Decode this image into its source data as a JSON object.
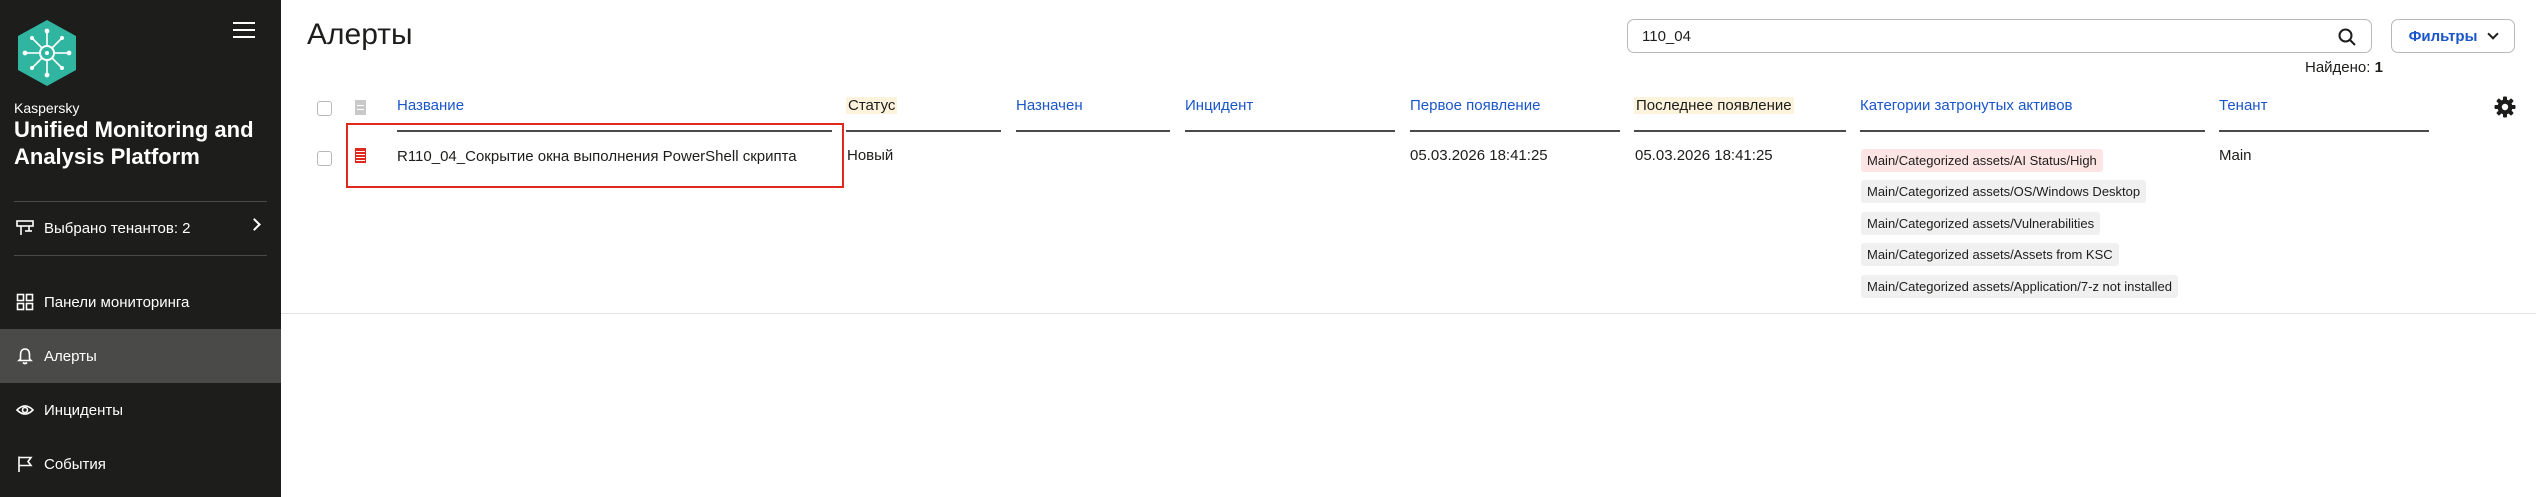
{
  "sidebar": {
    "brand_small": "Kaspersky",
    "brand_title": "Unified Monitoring and Analysis Platform",
    "tenants_label": "Выбрано тенантов: 2",
    "items": [
      {
        "label": "Панели мониторинга",
        "icon": "dashboard-icon",
        "active": false
      },
      {
        "label": "Алерты",
        "icon": "bell-icon",
        "active": true
      },
      {
        "label": "Инциденты",
        "icon": "eye-icon",
        "active": false
      },
      {
        "label": "События",
        "icon": "flag-icon",
        "active": false
      }
    ]
  },
  "header": {
    "title": "Алерты",
    "search_value": "110_04",
    "filters_label": "Фильтры",
    "found_label": "Найдено:",
    "found_count": "1"
  },
  "table": {
    "columns": {
      "name": "Название",
      "status": "Статус",
      "assigned": "Назначен",
      "incident": "Инцидент",
      "first_seen": "Первое появление",
      "last_seen": "Последнее появление",
      "asset_categories": "Категории затронутых активов",
      "tenant": "Тенант"
    },
    "sorted_columns": [
      "status",
      "last_seen"
    ],
    "rows": [
      {
        "severity": "high",
        "severity_color": "#e0291c",
        "name": "R110_04_Сокрытие окна выполнения PowerShell скрипта",
        "status": "Новый",
        "assigned": "",
        "incident": "",
        "first_seen": "05.03.2026 18:41:25",
        "last_seen": "05.03.2026 18:41:25",
        "asset_categories": [
          "Main/Categorized assets/AI Status/High",
          "Main/Categorized assets/OS/Windows Desktop",
          "Main/Categorized assets/Vulnerabilities",
          "Main/Categorized assets/Assets from KSC",
          "Main/Categorized assets/Application/7-z not installed"
        ],
        "tenant": "Main"
      }
    ]
  },
  "colors": {
    "sidebar_bg": "#1d1d1b",
    "sidebar_active": "#4a4a48",
    "link": "#1a56c9",
    "severity_high": "#e0291c",
    "highlight_outline": "#e0291c"
  }
}
